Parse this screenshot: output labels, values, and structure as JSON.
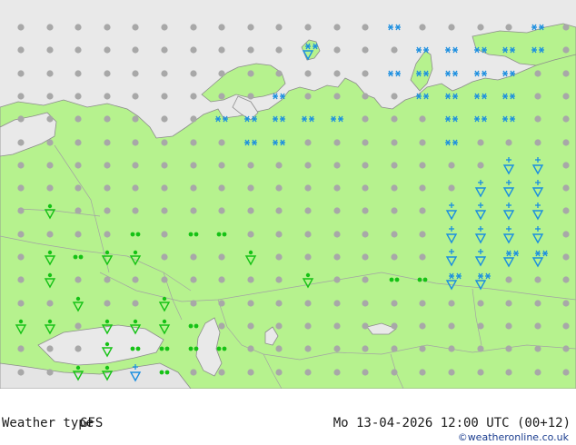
{
  "map": {
    "colors": {
      "sea": "#e9e9e9",
      "land_background": "#e4e4e4",
      "land_forecast": "#b6f28e",
      "border": "#a3a3a3",
      "coast": "#8c8c8c",
      "no_precip_dot": "#a8a8a8",
      "rain_symbol": "#15c215",
      "snow_symbol": "#1a8ee0"
    },
    "symbols": {
      "rows": 17,
      "cols": 20,
      "legend_names": [
        "dry-dot",
        "rain-drizzle",
        "rain-shower",
        "snow",
        "snow-shower",
        "sleet-shower"
      ]
    }
  },
  "footer": {
    "title": "Weather type",
    "model": "GFS",
    "valid_time": "Mo 13-04-2026 12:00 UTC (00+12)",
    "credit": "©weatheronline.co.uk"
  }
}
